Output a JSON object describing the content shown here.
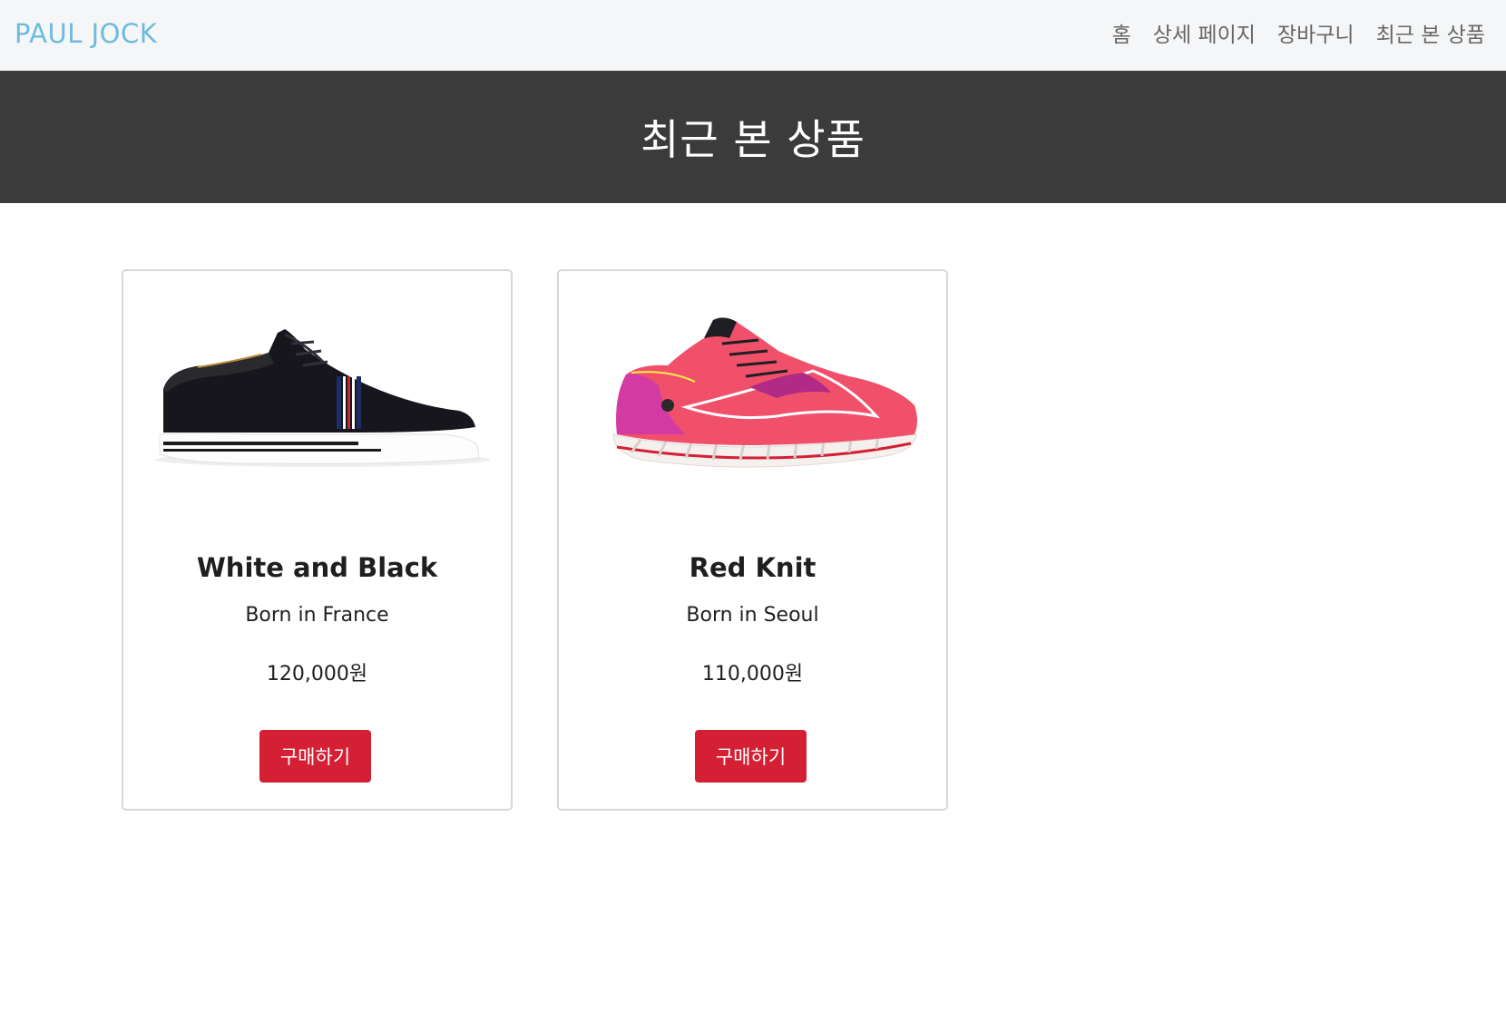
{
  "colors": {
    "brand": "#6ebbdf",
    "hero_background": "#3c3b3c",
    "buy_button": "#d41f34"
  },
  "navbar": {
    "brand": "PAUL JOCK",
    "links": [
      "홈",
      "상세 페이지",
      "장바구니",
      "최근 본 상품"
    ]
  },
  "hero": {
    "title": "최근 본 상품"
  },
  "products": [
    {
      "name": "White and Black",
      "origin": "Born in France",
      "price": "120,000원",
      "button_label": "구매하기",
      "image_icon": "black-sneaker-image"
    },
    {
      "name": "Red Knit",
      "origin": "Born in Seoul",
      "price": "110,000원",
      "button_label": "구매하기",
      "image_icon": "red-running-shoe-image"
    }
  ]
}
